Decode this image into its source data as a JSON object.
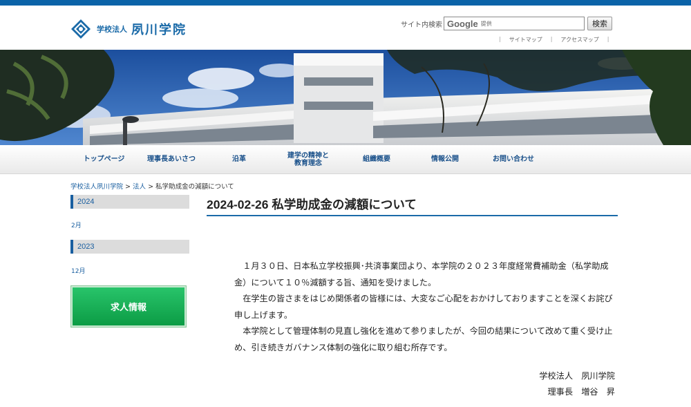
{
  "colors": {
    "brand_blue": "#0a63a8",
    "nav_text": "#19508a",
    "recruit_green": "#13a850"
  },
  "logo": {
    "prefix": "学校法人",
    "name": "夙川学院",
    "icon": "school-emblem-icon"
  },
  "search": {
    "label": "サイト内検索",
    "provider": "Google",
    "provider_suffix": "提供",
    "button": "検索"
  },
  "utility_links": [
    "サイトマップ",
    "アクセスマップ"
  ],
  "nav": [
    {
      "label": "トップページ"
    },
    {
      "label": "理事長あいさつ"
    },
    {
      "label": "沿革"
    },
    {
      "label": "建学の精神と\n教育理念"
    },
    {
      "label": "組織概要"
    },
    {
      "label": "情報公開"
    },
    {
      "label": "お問い合わせ"
    }
  ],
  "breadcrumb": {
    "items": [
      "学校法人夙川学院",
      "法人"
    ],
    "current": "私学助成金の減額について",
    "separator": ">"
  },
  "sidebar": {
    "years": [
      {
        "year": "2024",
        "months": [
          "2月"
        ]
      },
      {
        "year": "2023",
        "months": [
          "12月"
        ]
      }
    ],
    "recruit_button": "求人情報"
  },
  "post": {
    "title": "2024-02-26 私学助成金の減額について",
    "paragraphs": [
      "１月３０日、日本私立学校振興･共済事業団より、本学院の２０２３年度経常費補助金（私学助成金）について１０％減額する旨、通知を受けました。",
      "在学生の皆さまをはじめ関係者の皆様には、大変なご心配をおかけしておりますことを深くお詫び申し上げます。",
      "本学院として管理体制の見直し強化を進めて参りましたが、今回の結果について改めて重く受け止め、引き続きガバナンス体制の強化に取り組む所存です。"
    ],
    "signature": [
      "学校法人　夙川学院",
      "理事長　増谷　昇"
    ]
  }
}
